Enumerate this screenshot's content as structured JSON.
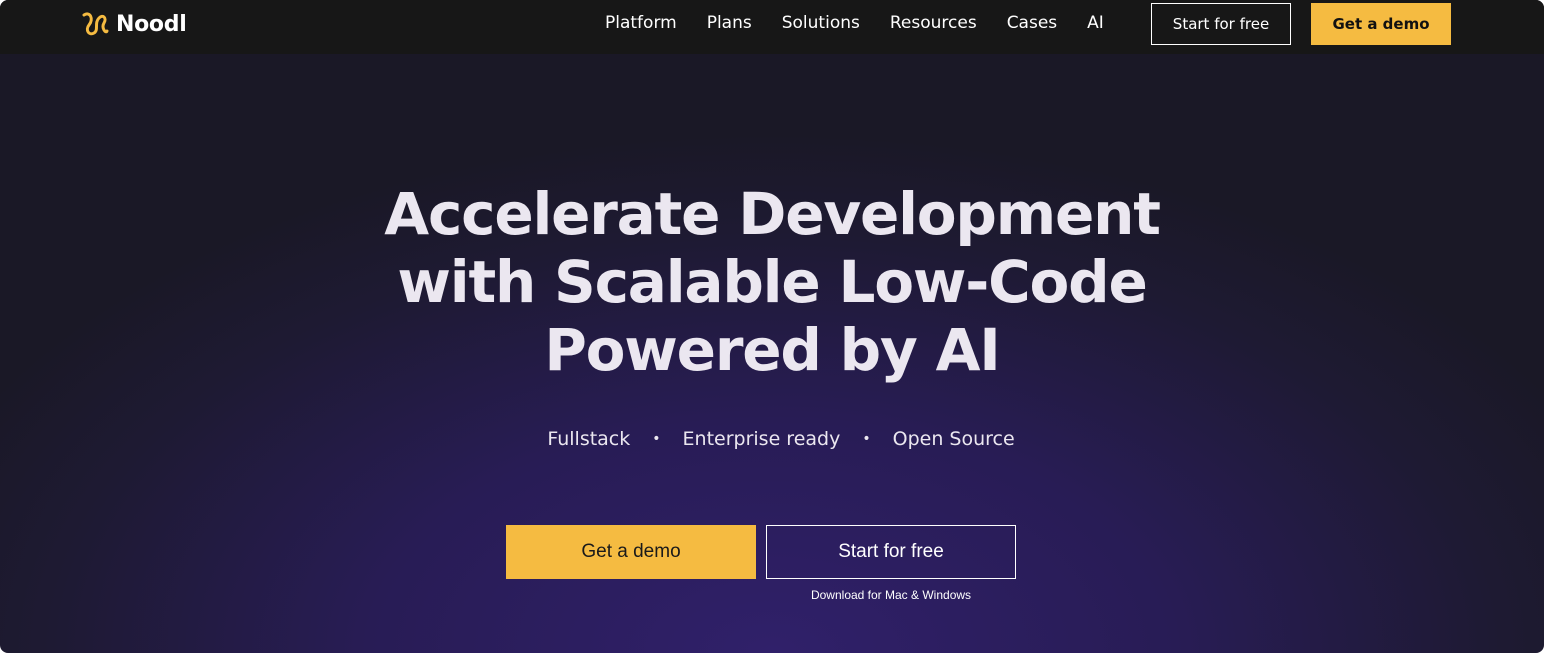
{
  "brand": {
    "name": "Noodl",
    "logo_icon": "noodl-logo-icon",
    "accent_color": "#f5bb41"
  },
  "nav": {
    "items": [
      {
        "label": "Platform"
      },
      {
        "label": "Plans"
      },
      {
        "label": "Solutions"
      },
      {
        "label": "Resources"
      },
      {
        "label": "Cases"
      },
      {
        "label": "AI"
      }
    ],
    "start_free_label": "Start for free",
    "get_demo_label": "Get a demo"
  },
  "hero": {
    "title_lines": [
      "Accelerate Development",
      "with Scalable Low-Code",
      "Powered by AI"
    ],
    "tags": [
      "Fullstack",
      "Enterprise ready",
      "Open Source"
    ],
    "tag_separator": "•",
    "cta_demo_label": "Get a demo",
    "cta_free_label": "Start for free",
    "download_note": "Download for Mac & Windows"
  },
  "colors": {
    "header_bg": "#171717",
    "hero_bg": "#281c55",
    "button_yellow": "#f5bb41"
  }
}
